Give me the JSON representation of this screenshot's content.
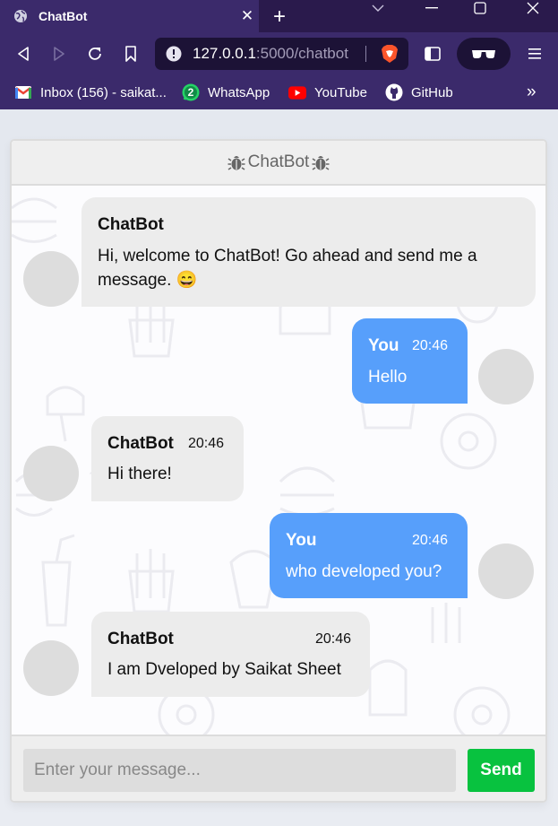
{
  "browser": {
    "tab_title": "ChatBot",
    "tab_close": "✕",
    "new_tab": "+",
    "url_host": "127.0.0.1",
    "url_path": ":5000/chatbot",
    "bookmarks": [
      {
        "label": "Inbox (156) - saikat...",
        "icon": "gmail-icon"
      },
      {
        "label": "WhatsApp",
        "icon": "whatsapp-icon",
        "badge": "2"
      },
      {
        "label": "YouTube",
        "icon": "youtube-icon"
      },
      {
        "label": "GitHub",
        "icon": "github-icon"
      }
    ],
    "more": "»"
  },
  "chat": {
    "header_title": "ChatBot",
    "messages": [
      {
        "sender": "ChatBot",
        "time": "",
        "text": "Hi, welcome to ChatBot! Go ahead and send me a",
        "text2": "message. 😄",
        "side": "left"
      },
      {
        "sender": "You",
        "time": "20:46",
        "text": "Hello",
        "side": "right"
      },
      {
        "sender": "ChatBot",
        "time": "20:46",
        "text": "Hi there!",
        "side": "left"
      },
      {
        "sender": "You",
        "time": "20:46",
        "text": "who developed you?",
        "side": "right"
      },
      {
        "sender": "ChatBot",
        "time": "20:46",
        "text": "I am Dveloped by Saikat Sheet",
        "side": "left"
      }
    ],
    "input_placeholder": "Enter your message...",
    "send_label": "Send"
  },
  "colors": {
    "bot_bubble": "#ececec",
    "user_bubble": "#579ffb",
    "send_button": "#08c23f",
    "browser_chrome": "#3b2a6b"
  }
}
